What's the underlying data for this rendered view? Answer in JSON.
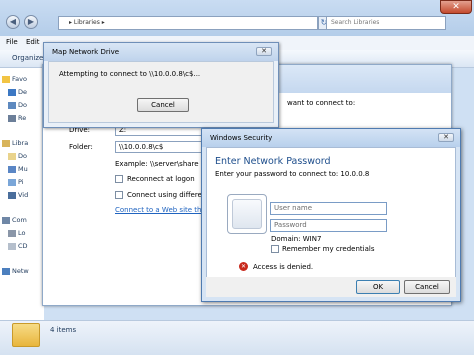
{
  "explorer": {
    "address_text": "▸ Libraries ▸",
    "search_placeholder": "Search Libraries",
    "menu": [
      "File",
      "Edit"
    ],
    "organize_label": "Organize ▾",
    "nav_items": [
      "Favo",
      "De",
      "Do",
      "Re",
      "Libra",
      "Do",
      "Mu",
      "Pi",
      "Vid",
      "Com",
      "Lo",
      "CD",
      "Netw"
    ],
    "status_items": "4 items"
  },
  "wizard": {
    "prompt_text": "want to connect to:",
    "drive_label": "Drive:",
    "drive_value": "Z:",
    "folder_label": "Folder:",
    "folder_value": "\\\\10.0.0.8\\c$",
    "example_text": "Example: \\\\server\\share",
    "reconnect_label": "Reconnect at logon",
    "different_credentials_label": "Connect using different c",
    "link_text": "Connect to a Web site that yo"
  },
  "connect_dialog": {
    "title": "Map Network Drive",
    "message": "Attempting to connect to \\\\10.0.0.8\\c$...",
    "cancel_label": "Cancel",
    "close_glyph": "✕"
  },
  "security_dialog": {
    "title": "Windows Security",
    "heading": "Enter Network Password",
    "subheading": "Enter your password to connect to: 10.0.0.8",
    "username_placeholder": "User name",
    "password_placeholder": "Password",
    "domain_text": "Domain: WIN7",
    "remember_label": "Remember my credentials",
    "error_text": "Access is denied.",
    "ok_label": "OK",
    "cancel_label": "Cancel",
    "close_glyph": "✕"
  },
  "colors": {
    "heading_blue": "#1e4e8c",
    "link_blue": "#2064c0",
    "error_red": "#c8291c"
  }
}
